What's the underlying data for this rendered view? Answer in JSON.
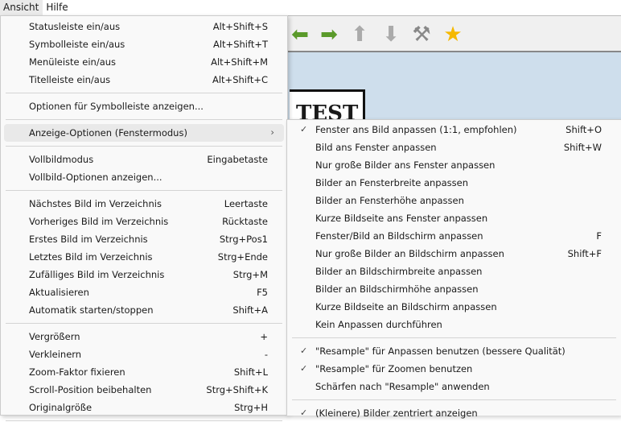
{
  "menubar": [
    "Ansicht",
    "Hilfe"
  ],
  "toolbar_icons": [
    "arrow-left-icon",
    "arrow-right-icon",
    "arrow-up-icon",
    "arrow-down-icon",
    "tools-icon",
    "star-icon"
  ],
  "image_text": "TEST",
  "menu_main": [
    {
      "label": "Statusleiste ein/aus",
      "shortcut": "Alt+Shift+S"
    },
    {
      "label": "Symbolleiste ein/aus",
      "shortcut": "Alt+Shift+T"
    },
    {
      "label": "Menüleiste ein/aus",
      "shortcut": "Alt+Shift+M"
    },
    {
      "label": "Titelleiste ein/aus",
      "shortcut": "Alt+Shift+C"
    },
    {
      "sep": true
    },
    {
      "label": "Optionen für Symbolleiste anzeigen..."
    },
    {
      "sep": true
    },
    {
      "label": "Anzeige-Optionen (Fenstermodus)",
      "submenu": true,
      "highlighted": true
    },
    {
      "sep": true
    },
    {
      "label": "Vollbildmodus",
      "shortcut": "Eingabetaste"
    },
    {
      "label": "Vollbild-Optionen anzeigen..."
    },
    {
      "sep": true
    },
    {
      "label": "Nächstes Bild im Verzeichnis",
      "shortcut": "Leertaste"
    },
    {
      "label": "Vorheriges Bild im Verzeichnis",
      "shortcut": "Rücktaste"
    },
    {
      "label": "Erstes Bild im Verzeichnis",
      "shortcut": "Strg+Pos1"
    },
    {
      "label": "Letztes Bild im Verzeichnis",
      "shortcut": "Strg+Ende"
    },
    {
      "label": "Zufälliges Bild im Verzeichnis",
      "shortcut": "Strg+M"
    },
    {
      "label": "Aktualisieren",
      "shortcut": "F5"
    },
    {
      "label": "Automatik starten/stoppen",
      "shortcut": "Shift+A"
    },
    {
      "sep": true
    },
    {
      "label": "Vergrößern",
      "shortcut": "+"
    },
    {
      "label": "Verkleinern",
      "shortcut": "-"
    },
    {
      "label": "Zoom-Faktor fixieren",
      "shortcut": "Shift+L"
    },
    {
      "label": "Scroll-Position beibehalten",
      "shortcut": "Strg+Shift+K"
    },
    {
      "label": "Originalgröße",
      "shortcut": "Strg+H"
    },
    {
      "sep": true
    }
  ],
  "menu_sub": [
    {
      "label": "Fenster ans Bild anpassen (1:1, empfohlen)",
      "shortcut": "Shift+O",
      "checked": true
    },
    {
      "label": "Bild ans Fenster anpassen",
      "shortcut": "Shift+W"
    },
    {
      "label": "Nur große Bilder ans Fenster anpassen"
    },
    {
      "label": "Bilder an Fensterbreite anpassen"
    },
    {
      "label": "Bilder an Fensterhöhe anpassen"
    },
    {
      "label": "Kurze Bildseite ans Fenster anpassen"
    },
    {
      "label": "Fenster/Bild an Bildschirm anpassen",
      "shortcut": "F"
    },
    {
      "label": "Nur große Bilder an Bildschirm anpassen",
      "shortcut": "Shift+F"
    },
    {
      "label": "Bilder an Bildschirmbreite anpassen"
    },
    {
      "label": "Bilder an Bildschirmhöhe anpassen"
    },
    {
      "label": "Kurze Bildseite an Bildschirm anpassen"
    },
    {
      "label": "Kein Anpassen durchführen"
    },
    {
      "sep": true
    },
    {
      "label": "\"Resample\" für Anpassen benutzen (bessere Qualität)",
      "checked": true
    },
    {
      "label": "\"Resample\" für Zoomen benutzen",
      "checked": true
    },
    {
      "label": "Schärfen nach \"Resample\" anwenden"
    },
    {
      "sep": true
    },
    {
      "label": "(Kleinere) Bilder zentriert anzeigen",
      "checked": true
    }
  ],
  "checkmark": "✓",
  "arrow": "›"
}
